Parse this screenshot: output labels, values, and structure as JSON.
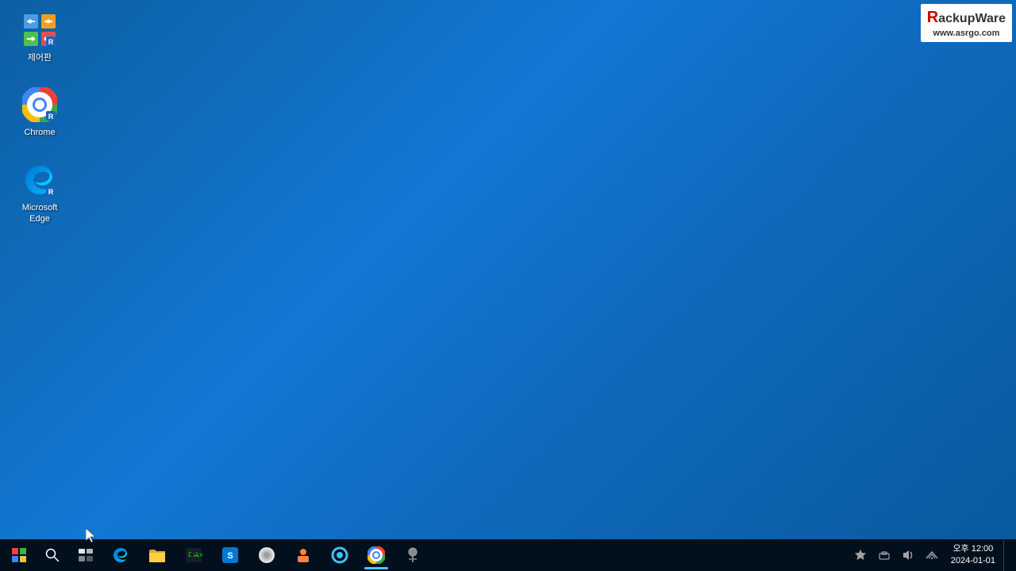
{
  "desktop": {
    "background_color": "#0f6bbf"
  },
  "icons": [
    {
      "id": "control-panel",
      "label": "제어판",
      "type": "control-panel"
    },
    {
      "id": "chrome",
      "label": "Chrome",
      "type": "chrome"
    },
    {
      "id": "microsoft-edge",
      "label": "Microsoft Edge",
      "type": "edge"
    }
  ],
  "watermark": {
    "title_prefix": "R",
    "title_rest": "ackupWare",
    "url": "www.asrgo.com"
  },
  "taskbar": {
    "items": [
      {
        "id": "start",
        "label": "Start"
      },
      {
        "id": "search",
        "label": "Search"
      },
      {
        "id": "task-view",
        "label": "Task View"
      },
      {
        "id": "edge-taskbar",
        "label": "Microsoft Edge"
      },
      {
        "id": "file-explorer",
        "label": "File Explorer"
      },
      {
        "id": "terminal",
        "label": "Terminal"
      },
      {
        "id": "store",
        "label": "Store"
      },
      {
        "id": "app8",
        "label": "App"
      },
      {
        "id": "app9",
        "label": "App"
      },
      {
        "id": "app10",
        "label": "App"
      },
      {
        "id": "chrome-taskbar",
        "label": "Chrome"
      },
      {
        "id": "app12",
        "label": "App"
      }
    ],
    "clock": {
      "time": "12:00",
      "date": "2024-01-01"
    }
  }
}
